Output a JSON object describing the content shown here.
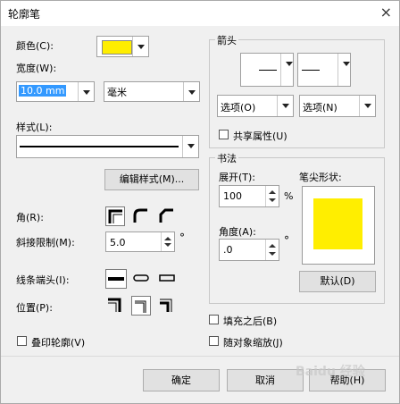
{
  "window": {
    "title": "轮廓笔",
    "close": "×"
  },
  "left": {
    "color_label": "颜色(C):",
    "color_value": "#ffee00",
    "width_label": "宽度(W):",
    "width_value": "10.0 mm",
    "unit_value": "毫米",
    "style_label": "样式(L):",
    "edit_style_button": "编辑样式(M)...",
    "corner_label": "角(R):",
    "miter_label": "斜接限制(M):",
    "miter_value": "5.0",
    "miter_unit": "°",
    "linecap_label": "线条端头(I):",
    "position_label": "位置(P):",
    "overprint_label": "叠印轮廓(V)"
  },
  "arrows": {
    "group_title": "箭头",
    "options_left": "选项(O)",
    "options_right": "选项(N)",
    "share_label": "共享属性(U)"
  },
  "calligraphy": {
    "group_title": "书法",
    "stretch_label": "展开(T):",
    "stretch_value": "100",
    "stretch_unit": "%",
    "angle_label": "角度(A):",
    "angle_value": ".0",
    "angle_unit": "°",
    "nib_label": "笔尖形状:",
    "nib_color": "#ffee00",
    "default_button": "默认(D)"
  },
  "options": {
    "behind_fill": "填充之后(B)",
    "scale_with_object": "随对象缩放(J)"
  },
  "footer": {
    "ok": "确定",
    "cancel": "取消",
    "help": "帮助(H)"
  },
  "watermark_text": "Baidu 经验"
}
